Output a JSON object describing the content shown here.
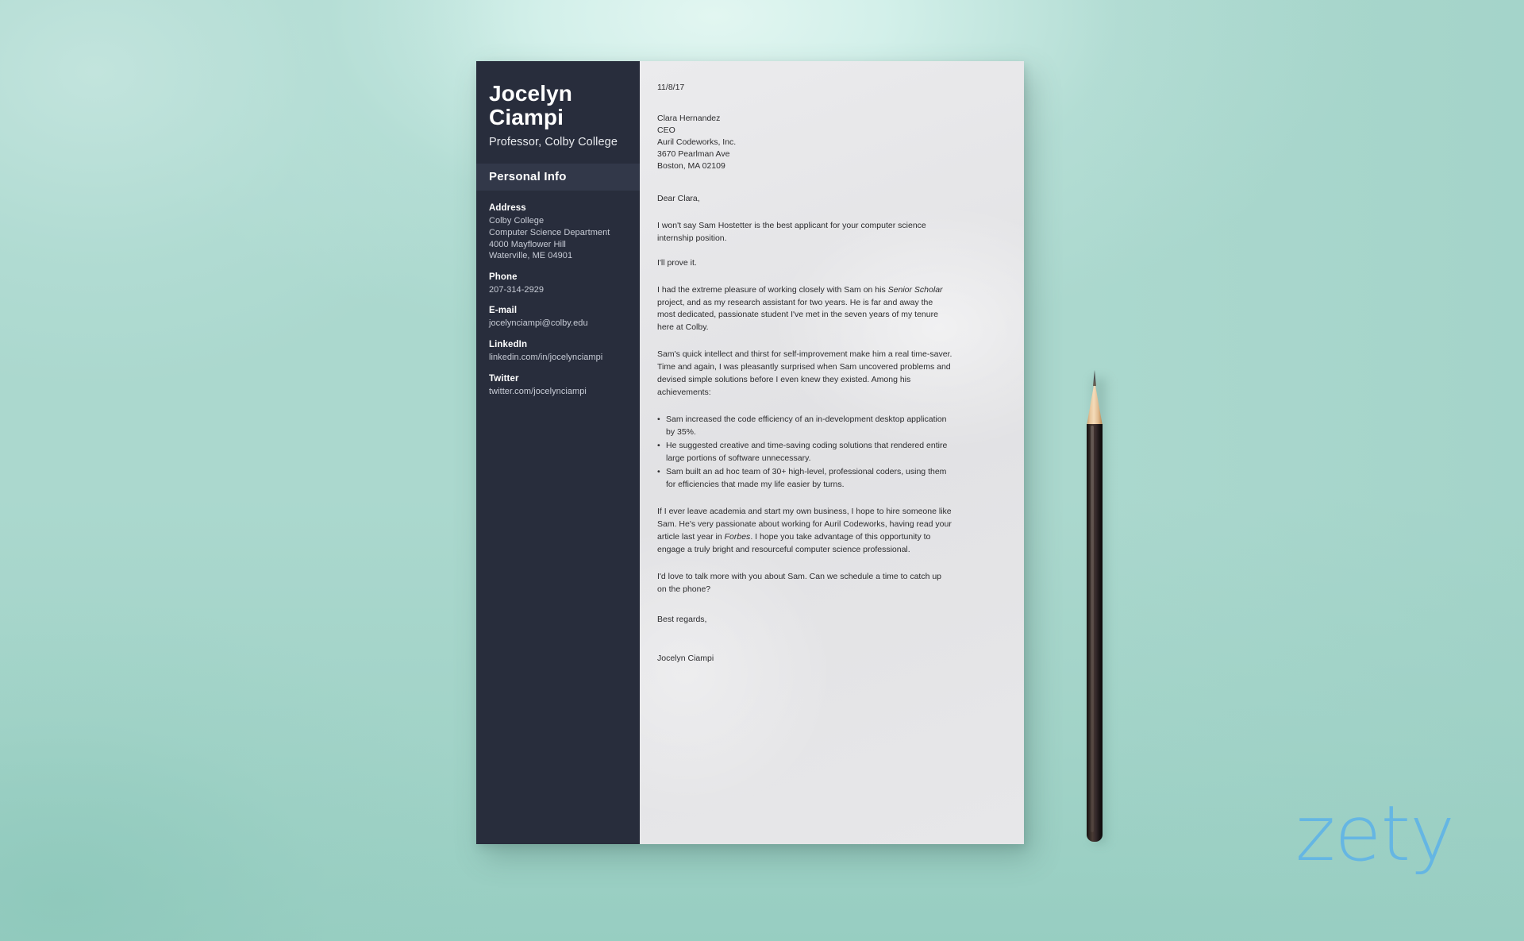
{
  "background": {
    "base_color": "#abd8ce",
    "highlight_color": "#e2f6f1",
    "shade_color": "#92cbbe"
  },
  "sidebar": {
    "name": "Jocelyn Ciampi",
    "name_first": "Jocelyn",
    "name_last": "Ciampi",
    "title": "Professor, Colby College",
    "section_heading": "Personal Info",
    "background_color": "#282d3c",
    "band_color": "#323849",
    "contact_groups": [
      {
        "label": "Address",
        "lines": [
          "Colby College",
          "Computer Science Department",
          "4000 Mayflower Hill",
          "Waterville, ME 04901"
        ]
      },
      {
        "label": "Phone",
        "lines": [
          "207-314-2929"
        ]
      },
      {
        "label": "E-mail",
        "lines": [
          "jocelynciampi@colby.edu"
        ]
      },
      {
        "label": "LinkedIn",
        "lines": [
          "linkedin.com/in/jocelynciampi"
        ]
      },
      {
        "label": "Twitter",
        "lines": [
          "twitter.com/jocelynciampi"
        ]
      }
    ]
  },
  "letter": {
    "date": "11/8/17",
    "recipient": [
      "Clara Hernandez",
      "CEO",
      "Auril Codeworks, Inc.",
      "3670 Pearlman Ave",
      "Boston, MA 02109"
    ],
    "salutation": "Dear Clara,",
    "para1": "I won't say Sam Hostetter is the best applicant for your computer science internship position.",
    "para2": "I'll prove it.",
    "para3_before": "I had the extreme pleasure of working closely with Sam on his ",
    "para3_italic": "Senior Scholar",
    "para3_after": " project, and as my research assistant for two years. He is far and away the most dedicated, passionate student I've met in the seven years of my tenure here at Colby.",
    "para4": "Sam's quick intellect and thirst for self-improvement make him a real time-saver. Time and again, I was pleasantly surprised when Sam uncovered problems and devised simple solutions before I even knew they existed. Among his achievements:",
    "bullets": [
      "Sam increased the code efficiency of an in-development desktop application by 35%.",
      "He suggested creative and time-saving coding solutions that rendered entire large portions of software unnecessary.",
      "Sam built an ad hoc team of 30+ high-level, professional coders, using them for efficiencies that made my life easier by turns."
    ],
    "para5_before": "If I ever leave academia and start my own business, I hope to hire someone like Sam. He's very passionate about working for Auril Codeworks, having read your article last year in ",
    "para5_italic": "Forbes",
    "para5_after": ". I hope you take advantage of this opportunity to engage a truly bright and resourceful computer science professional.",
    "para6": "I'd love to talk more with you about Sam. Can we schedule a time to catch up on the phone?",
    "closing": "Best regards,",
    "signature": "Jocelyn Ciampi"
  },
  "watermark": {
    "text": "zety",
    "color": "#63b5e5"
  },
  "objects": {
    "pencil": "pencil"
  }
}
